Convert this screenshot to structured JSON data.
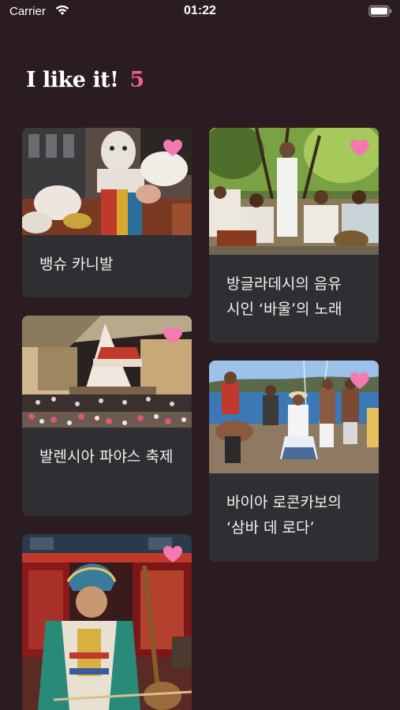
{
  "status": {
    "carrier": "Carrier",
    "time": "01:22"
  },
  "header": {
    "title": "I like it!",
    "count": "5"
  },
  "colors": {
    "background": "#2a1c20",
    "card": "#2f2f33",
    "accent": "#ee5d97"
  },
  "cards": [
    {
      "title": "뱅슈 카니발",
      "liked": true,
      "icon": "heart-icon"
    },
    {
      "title": "방글라데시의 음유 시인 ‘바울’의 노래",
      "liked": true,
      "icon": "heart-icon"
    },
    {
      "title": "발렌시아 파야스 축제",
      "liked": true,
      "icon": "heart-icon"
    },
    {
      "title": "바이아 로콘카보의 ‘삼바 데 로다’",
      "liked": true,
      "icon": "heart-icon"
    },
    {
      "title": "",
      "liked": true,
      "icon": "heart-icon"
    }
  ]
}
